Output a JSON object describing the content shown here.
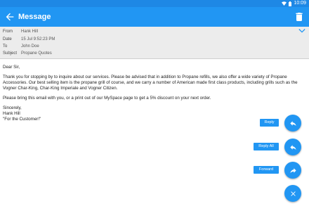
{
  "status": {
    "time": "10:09"
  },
  "appbar": {
    "title": "Message"
  },
  "header": {
    "rows": [
      {
        "label": "From",
        "value": "Hank Hill"
      },
      {
        "label": "Date",
        "value": "15 Jul 9:52:23 PM"
      },
      {
        "label": "To",
        "value": "John Doe"
      },
      {
        "label": "Subject",
        "value": "Propane Quotes"
      }
    ]
  },
  "message": {
    "greeting": "Dear Sir,",
    "paragraph1": "Thank you for stopping by to inquire about our services. Please be advised that in addition to Propane refills, we also offer a wide variety of Propane Accessories. Our best selling item is the propane grill of course, and we carry a number of American made first class products, including grills such as the Vogner Char-King, Char-King Imperiale and Vogner Citizen.",
    "paragraph2": "Please bring this email with you, or a print out of our MySpace page to get a 5% discount on your next order.",
    "closing": "Sincerely,",
    "signature_name": "Hank Hill",
    "signature_tagline": "\"For the Customer!\""
  },
  "actions": {
    "reply_label": "Reply",
    "reply_all_label": "Reply All",
    "forward_label": "Forward"
  },
  "colors": {
    "primary": "#2196f3",
    "statusbar": "#1e88e5",
    "header_bg": "#ececec"
  },
  "icons": {
    "back": "arrow-left-icon",
    "delete": "trash-icon",
    "expand": "chevron-down-icon",
    "reply": "reply-icon",
    "reply_all": "reply-all-icon",
    "forward": "forward-icon",
    "close": "close-icon"
  }
}
